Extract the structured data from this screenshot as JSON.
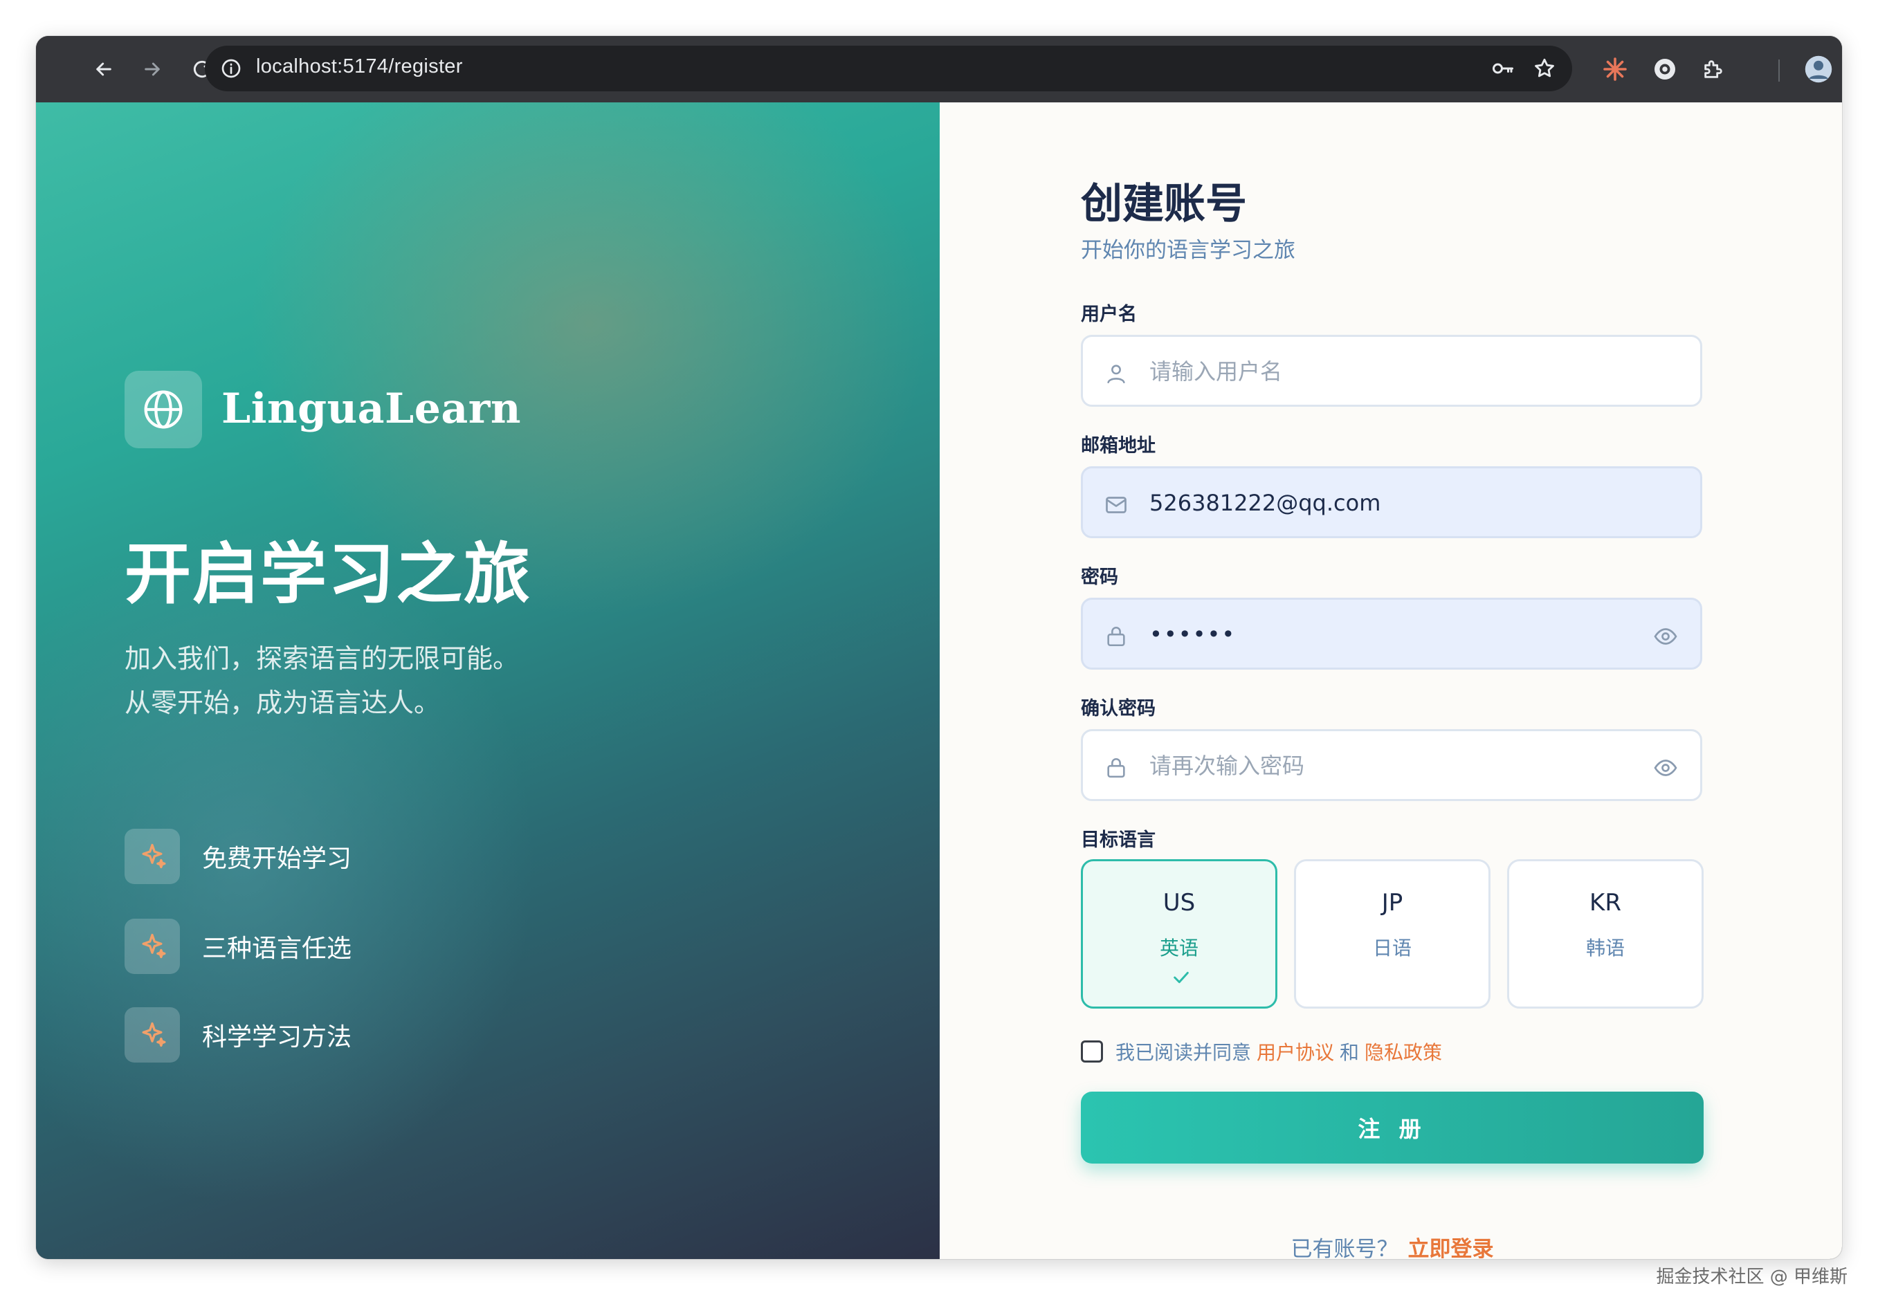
{
  "browser": {
    "url": "localhost:5174/register",
    "icons": [
      "back-arrow-icon",
      "forward-arrow-icon",
      "reload-icon",
      "site-info-icon",
      "password-key-icon",
      "bookmark-star-icon",
      "extension-sparkle-icon",
      "extension-tool-icon",
      "extensions-puzzle-icon",
      "profile-avatar",
      "menu-dots-icon"
    ]
  },
  "hero": {
    "brand": "LinguaLearn",
    "title": "开启学习之旅",
    "desc_line1": "加入我们，探索语言的无限可能。",
    "desc_line2": "从零开始，成为语言达人。",
    "features": [
      {
        "label": "免费开始学习",
        "icon": "sparkle-icon"
      },
      {
        "label": "三种语言任选",
        "icon": "sparkle-icon"
      },
      {
        "label": "科学学习方法",
        "icon": "sparkle-icon"
      }
    ]
  },
  "form": {
    "title": "创建账号",
    "subtitle": "开始你的语言学习之旅",
    "username": {
      "label": "用户名",
      "value": "",
      "placeholder": "请输入用户名"
    },
    "email": {
      "label": "邮箱地址",
      "value": "526381222@qq.com",
      "placeholder": ""
    },
    "password": {
      "label": "密码",
      "value": "••••••",
      "placeholder": ""
    },
    "confirm": {
      "label": "确认密码",
      "value": "",
      "placeholder": "请再次输入密码"
    },
    "language_label": "目标语言",
    "languages": [
      {
        "code": "US",
        "name": "英语",
        "selected": true
      },
      {
        "code": "JP",
        "name": "日语",
        "selected": false
      },
      {
        "code": "KR",
        "name": "韩语",
        "selected": false
      }
    ],
    "agree_prefix": "我已阅读并同意",
    "agree_terms": "用户协议",
    "agree_and": "和",
    "agree_privacy": "隐私政策",
    "submit_label": "注 册",
    "has_account": "已有账号？",
    "login_link": "立即登录"
  },
  "watermark": "掘金技术社区 @ 甲维斯",
  "colors": {
    "accent": "#2dbcaa",
    "link": "#e8773a",
    "heading": "#1d2b4a",
    "muted": "#5f86b0"
  }
}
